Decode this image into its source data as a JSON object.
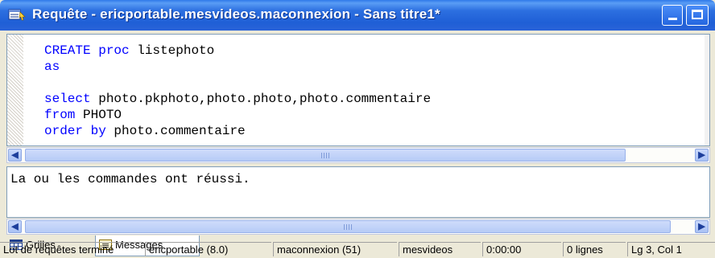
{
  "window": {
    "title": "Requête - ericportable.mesvideos.maconnexion - Sans titre1*",
    "controls": [
      "minimize",
      "maximize"
    ]
  },
  "editor": {
    "lines": [
      [
        {
          "t": "CREATE",
          "k": true
        },
        {
          "t": " "
        },
        {
          "t": "proc",
          "k": true
        },
        {
          "t": " listephoto"
        }
      ],
      [
        {
          "t": "as",
          "k": true
        }
      ],
      [
        {
          "t": ""
        }
      ],
      [
        {
          "t": "select",
          "k": true
        },
        {
          "t": " photo.pkphoto,photo.photo,photo.commentaire"
        }
      ],
      [
        {
          "t": "from",
          "k": true
        },
        {
          "t": " PHOTO"
        }
      ],
      [
        {
          "t": "order by",
          "k": true
        },
        {
          "t": " photo.commentaire"
        }
      ]
    ]
  },
  "results": {
    "message": "La ou les commandes ont réussi."
  },
  "tabs": [
    {
      "label": "Grilles",
      "icon": "grid-icon"
    },
    {
      "label": "Messages",
      "icon": "messages-icon",
      "active": true
    }
  ],
  "status": {
    "batch": "Lot de requêtes terminé",
    "server": "ericportable (8.0)",
    "connection": "maconnexion (51)",
    "database": "mesvideos",
    "elapsed": "0:00:00",
    "rows": "0 lignes",
    "position": "Lg 3, Col 1"
  },
  "colors": {
    "keyword": "#0000ff",
    "titlebar": "#2c6fe0",
    "chrome": "#ece9d8"
  }
}
